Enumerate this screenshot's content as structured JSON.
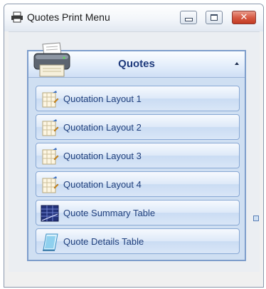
{
  "window": {
    "title": "Quotes Print Menu",
    "icon": "printer-icon"
  },
  "titlebar_buttons": {
    "minimize": "minimize-icon",
    "maximize": "maximize-icon",
    "close": "close-icon"
  },
  "panel": {
    "title": "Quotes",
    "header_icon": "printer-icon",
    "collapse_icon": "chevron-up-icon"
  },
  "items": [
    {
      "label": "Quotation Layout 1",
      "icon": "report-layout-icon"
    },
    {
      "label": "Quotation Layout 2",
      "icon": "report-layout-icon"
    },
    {
      "label": "Quotation Layout 3",
      "icon": "report-layout-icon"
    },
    {
      "label": "Quotation Layout 4",
      "icon": "report-layout-icon"
    },
    {
      "label": "Quote Summary Table",
      "icon": "summary-table-icon"
    },
    {
      "label": "Quote Details Table",
      "icon": "details-table-icon"
    }
  ],
  "colors": {
    "accent": "#1e3a7c",
    "panel_border": "#7d9dcb",
    "close_button": "#d75b45"
  }
}
